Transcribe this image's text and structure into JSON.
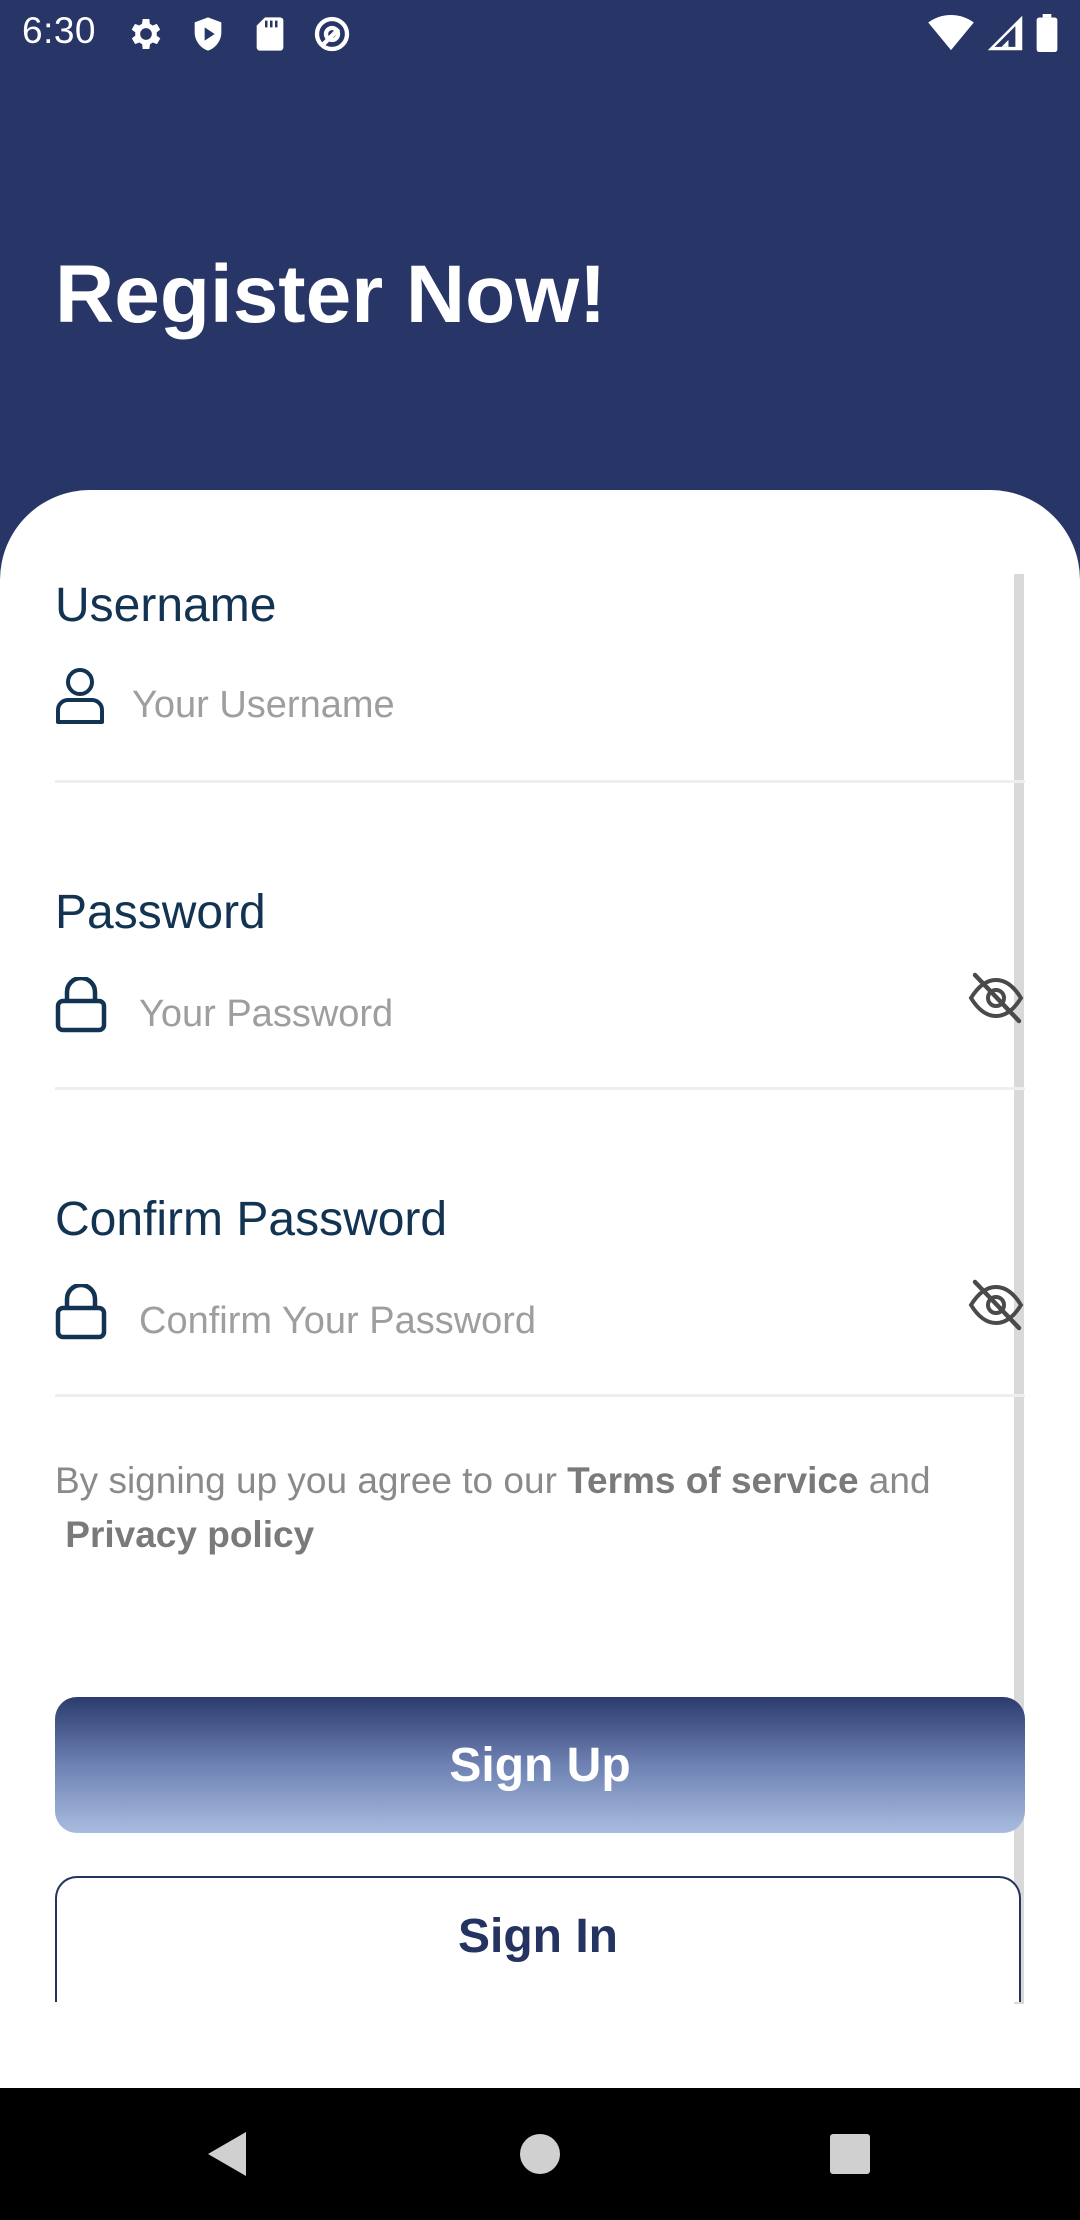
{
  "status_bar": {
    "time": "6:30",
    "left_icons": [
      "settings-icon",
      "shield-icon",
      "sd-card-icon",
      "at-sign-icon"
    ],
    "right_icons": [
      "wifi-icon",
      "cellular-signal-icon",
      "battery-icon"
    ]
  },
  "header": {
    "title": "Register Now!",
    "background_color": "#283567"
  },
  "form": {
    "username": {
      "label": "Username",
      "placeholder": "Your Username",
      "value": "",
      "icon": "user-icon"
    },
    "password": {
      "label": "Password",
      "placeholder": "Your Password",
      "value": "",
      "icon": "lock-icon",
      "toggle_icon": "eye-off-icon"
    },
    "confirm_password": {
      "label": "Confirm Password",
      "placeholder": "Confirm Your Password",
      "value": "",
      "icon": "lock-icon",
      "toggle_icon": "eye-off-icon"
    }
  },
  "terms": {
    "prefix": "By signing up you agree to our ",
    "terms_link": "Terms of service",
    "middle": " and",
    "privacy_link": "Privacy policy"
  },
  "buttons": {
    "sign_up": "Sign Up",
    "sign_in": "Sign In"
  },
  "nav_bar": {
    "icons": [
      "back-icon",
      "home-icon",
      "recents-icon"
    ]
  },
  "colors": {
    "primary": "#283567",
    "label": "#123352",
    "placeholder": "#9e9e9e"
  }
}
